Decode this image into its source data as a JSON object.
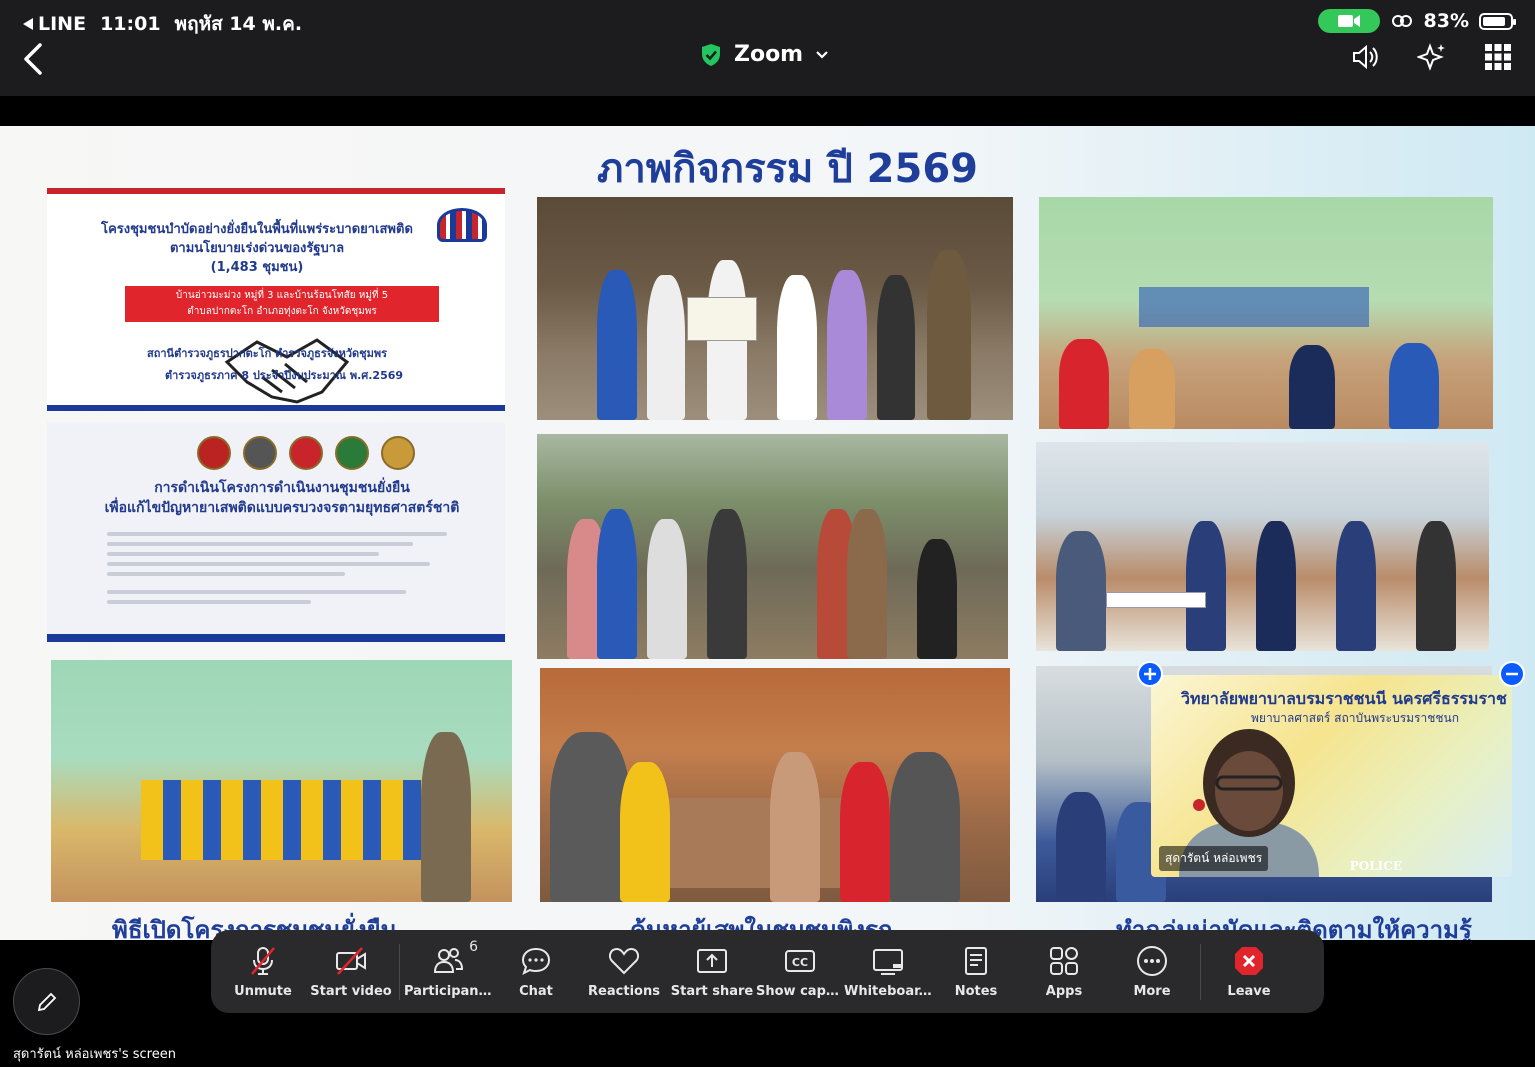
{
  "status_bar": {
    "back_app": "LINE",
    "time": "11:01",
    "date": "พฤหัส 14 พ.ค.",
    "battery_percent": "83%",
    "battery_level": 0.83
  },
  "header": {
    "title": "Zoom",
    "secure_color": "#22c55e"
  },
  "slide": {
    "title": "ภาพกิจกรรม ปี 2569",
    "banner1": {
      "title_line1": "โครงชุมชนบำบัดอย่างยั่งยืนในพื้นที่แพร่ระบาดยาเสพติด",
      "title_line2": "ตามนโยบายเร่งด่วนของรัฐบาล",
      "title_line3": "(1,483 ชุมชน)",
      "red_line1": "บ้านอ่าวมะม่วง หมู่ที่ 3 และบ้านร้อนโทสัย หมู่ที่ 5",
      "red_line2": "ตำบลปากตะโก อำเภอทุ่งตะโก จังหวัดชุมพร",
      "footer_line1": "สถานีตำรวจภูธรปากตะโก     ตำรวจภูธรจังหวัดชุมพร",
      "footer_line2": "ตำรวจภูธรภาค 8     ประจำปีงบประมาณ พ.ศ.2569"
    },
    "banner2": {
      "title_line1": "การดำเนินโครงการดำเนินงานชุมชนยั่งยืน",
      "title_line2": "เพื่อแก้ไขปัญหายาเสพติดแบบครบวงจรตามยุทธศาสตร์ชาติ"
    },
    "captions": {
      "left": "พิธีเปิดโครงการชุมชนยั่งยืน",
      "center": "ค้นหาผู้เสพในชุมชนพิงรถ",
      "right": "ทำฉลุ่มน่ามัดและติดตามให้ความรู้"
    }
  },
  "speaker_tile": {
    "header_line1": "วิทยาลัยพยาบาลบรมราชชนนี นครศรีธรรมราช",
    "header_line2": "พยาบาลศาสตร์ สถาบันพระบรมราชชนก",
    "name": "สุดารัตน์ หล่อเพชร",
    "badge": "POLICE"
  },
  "toolbar": {
    "items": [
      {
        "label": "Unmute",
        "icon": "mic-off-icon"
      },
      {
        "label": "Start video",
        "icon": "video-off-icon"
      },
      {
        "label": "Participants",
        "icon": "participants-icon",
        "count": "6"
      },
      {
        "label": "Chat",
        "icon": "chat-icon"
      },
      {
        "label": "Reactions",
        "icon": "heart-icon"
      },
      {
        "label": "Start share",
        "icon": "share-icon"
      },
      {
        "label": "Show capt...",
        "icon": "cc-icon"
      },
      {
        "label": "Whiteboar...",
        "icon": "whiteboard-icon"
      },
      {
        "label": "Notes",
        "icon": "notes-icon"
      },
      {
        "label": "Apps",
        "icon": "apps-icon"
      },
      {
        "label": "More",
        "icon": "more-icon"
      },
      {
        "label": "Leave",
        "icon": "leave-icon"
      }
    ],
    "leave_color": "#e0262c"
  },
  "screen_owner": "สุดารัตน์ หล่อเพชร's screen"
}
